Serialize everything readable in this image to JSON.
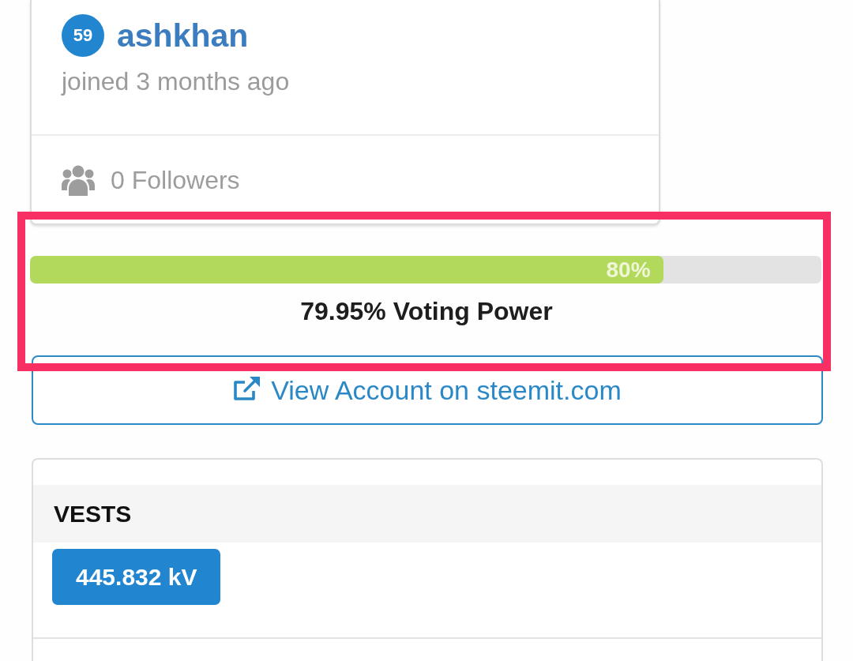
{
  "profile": {
    "reputation": "59",
    "username": "ashkhan",
    "joined": "joined 3 months ago",
    "followers": "0 Followers"
  },
  "voting_power": {
    "level": 0.8,
    "bar_label": "80%",
    "caption": "79.95% Voting Power",
    "highlighted": true
  },
  "view_account_button": {
    "label": "View Account on steemit.com"
  },
  "vests_card": {
    "header": "VESTS",
    "value": "445.832 kV"
  }
}
